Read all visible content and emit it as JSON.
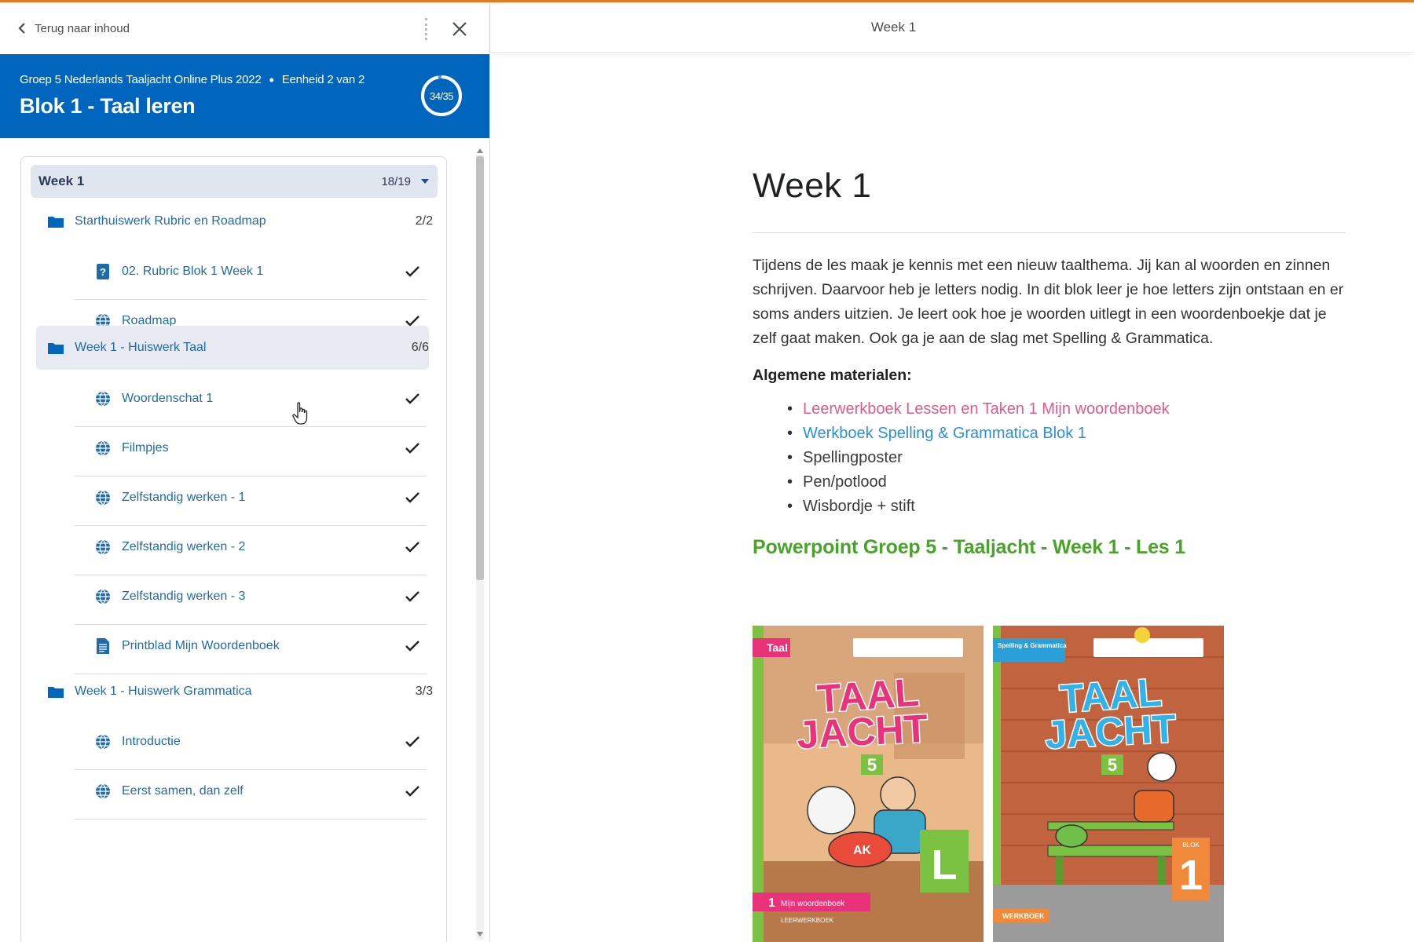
{
  "colors": {
    "accent_orange": "#e87722",
    "header_blue": "#0065bd",
    "link_blue": "#1f6aa8",
    "heading_green": "#4aa32a",
    "link_pink": "#e25a8a",
    "link_light_blue": "#2b8fd9"
  },
  "left_panel": {
    "back_label": "Terug naar inhoud",
    "close_icon": "close-icon",
    "course": {
      "name": "Groep 5 Nederlands Taaljacht Online Plus 2022",
      "unit": "Eenheid 2 van 2",
      "title": "Blok 1 - Taal leren",
      "progress_text": "34/35",
      "progress_fraction": 0.971
    },
    "week": {
      "label": "Week 1",
      "count": "18/19"
    },
    "items": [
      {
        "type": "folder",
        "label": "Starthuiswerk Rubric en Roadmap",
        "count": "2/2",
        "icon": "folder-icon"
      },
      {
        "type": "sub",
        "label": "02. Rubric Blok 1 Week 1",
        "icon": "quiz-icon",
        "done": true
      },
      {
        "type": "sub",
        "label": "Roadmap",
        "icon": "globe-icon",
        "done": true
      },
      {
        "type": "folder",
        "label": "Week 1 - Huiswerk Taal",
        "count": "6/6",
        "icon": "folder-icon",
        "highlighted": true
      },
      {
        "type": "sub",
        "label": "Woordenschat 1",
        "icon": "globe-icon",
        "done": true
      },
      {
        "type": "sub",
        "label": "Filmpjes",
        "icon": "globe-icon",
        "done": true
      },
      {
        "type": "sub",
        "label": "Zelfstandig werken - 1",
        "icon": "globe-icon",
        "done": true
      },
      {
        "type": "sub",
        "label": "Zelfstandig werken - 2",
        "icon": "globe-icon",
        "done": true
      },
      {
        "type": "sub",
        "label": "Zelfstandig werken - 3",
        "icon": "globe-icon",
        "done": true
      },
      {
        "type": "sub",
        "label": "Printblad Mijn Woordenboek",
        "icon": "document-icon",
        "done": true
      },
      {
        "type": "folder",
        "label": "Week 1 - Huiswerk Grammatica",
        "count": "3/3",
        "icon": "folder-icon"
      },
      {
        "type": "sub",
        "label": "Introductie",
        "icon": "globe-icon",
        "done": true
      },
      {
        "type": "sub",
        "label": "Eerst samen, dan zelf",
        "icon": "globe-icon",
        "done": true
      }
    ]
  },
  "right_panel": {
    "top_title": "Week 1",
    "heading": "Week 1",
    "intro": "Tijdens de les maak je kennis met een nieuw taalthema. Jij kan al woorden en zinnen schrijven. Daarvoor heb je letters nodig. In dit blok leer je hoe letters zijn ontstaan en er soms anders uitzien. Je leert ook hoe je woorden uitlegt in een woordenboekje dat je zelf gaat maken. Ook ga je aan de slag met Spelling & Grammatica.",
    "materials_title": "Algemene materialen:",
    "materials": [
      {
        "label": "Leerwerkboek Lessen en Taken 1 Mijn woordenboek",
        "style": "pink"
      },
      {
        "label": "Werkboek Spelling & Grammatica Blok 1",
        "style": "blue"
      },
      {
        "label": "Spellingposter",
        "style": "plain"
      },
      {
        "label": "Pen/potlood",
        "style": "plain"
      },
      {
        "label": "Wisbordje + stift",
        "style": "plain"
      }
    ],
    "powerpoint_title": "Powerpoint Groep 5 - Taaljacht - Week 1 - Les 1",
    "cover_left": {
      "tag": "Taal",
      "title_line1": "TAAL",
      "title_line2": "JACHT",
      "number": "5",
      "corner_letter": "L",
      "bottom_label": "Mijn woordenboek",
      "bottom_number": "1",
      "bottom_sub": "LEERWERKBOEK",
      "logo": "cover-left-taaljacht-art"
    },
    "cover_right": {
      "tag": "Spelling & Grammatica",
      "title_line1": "TAAL",
      "title_line2": "JACHT",
      "number": "5",
      "corner_number": "1",
      "corner_label": "BLOK",
      "bottom_sub": "WERKBOEK",
      "logo": "cover-right-taaljacht-art"
    }
  }
}
